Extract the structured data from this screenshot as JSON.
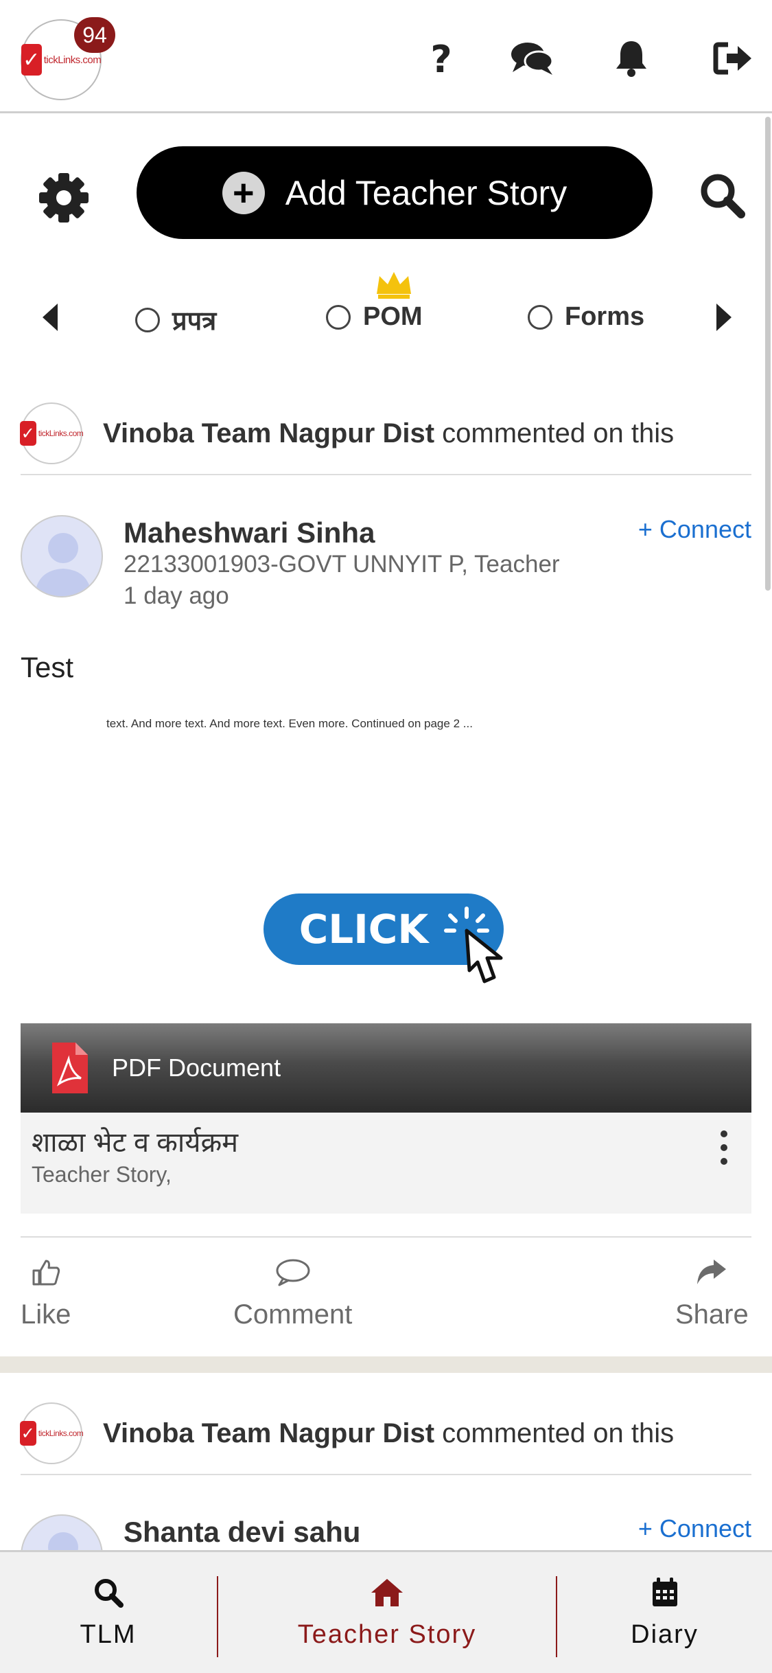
{
  "header": {
    "logo_text": "tickLinks.com",
    "notification_count": "94",
    "icons": [
      "help-icon",
      "chat-icon",
      "bell-icon",
      "logout-icon"
    ]
  },
  "actions": {
    "add_label": "Add Teacher Story"
  },
  "filters": {
    "items": [
      {
        "label": "प्रपत्र",
        "selected": false
      },
      {
        "label": "POM",
        "selected": false,
        "crowned": true
      },
      {
        "label": "Forms",
        "selected": false
      }
    ]
  },
  "feed": [
    {
      "activity_actor": "Vinoba Team Nagpur Dist",
      "activity_text": " commented on this",
      "author": "Maheshwari Sinha",
      "meta": "22133001903-GOVT UNNYIT P, Teacher",
      "time": "1 day ago",
      "connect_label": "+ Connect",
      "post_text": "Test",
      "preview_snippet": "text. And more text. And more text. Even more. Continued on page 2 ...",
      "click_label": "CLICK",
      "attachment_type": "PDF Document",
      "doc_title": "शाळा भेट व कार्यक्रम",
      "doc_category": "Teacher Story,",
      "like_label": "Like",
      "comment_label": "Comment",
      "share_label": "Share"
    },
    {
      "activity_actor": "Vinoba Team Nagpur Dist",
      "activity_text": " commented on this",
      "author": "Shanta devi sahu",
      "connect_label": "+ Connect"
    }
  ],
  "bottom_nav": {
    "items": [
      {
        "label": "TLM",
        "icon": "search-icon",
        "active": false
      },
      {
        "label": "Teacher Story",
        "icon": "home-icon",
        "active": true
      },
      {
        "label": "Diary",
        "icon": "calendar-icon",
        "active": false
      }
    ]
  },
  "colors": {
    "brand_red": "#8b1a1a",
    "link_blue": "#1a6fd0",
    "accent_black": "#000000",
    "crown_gold": "#f4c20d"
  }
}
